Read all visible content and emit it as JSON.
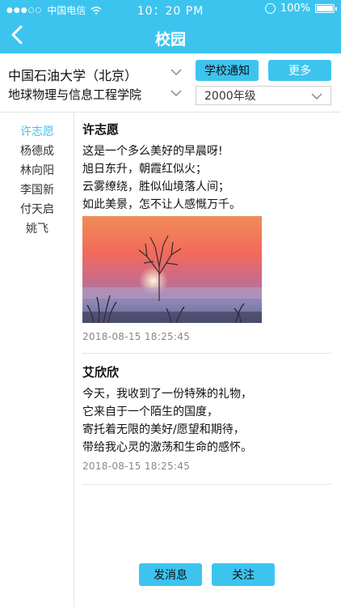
{
  "status_bar": {
    "carrier": "中国电信",
    "time": "10：20 PM",
    "battery": "100%"
  },
  "nav": {
    "title": "校园"
  },
  "filters": {
    "school": "中国石油大学（北京）",
    "college": "地球物理与信息工程学院",
    "grade": "2000年级",
    "notice_button": "学校通知",
    "more_button": "更多"
  },
  "sidebar": {
    "items": [
      {
        "label": "许志愿",
        "active": true
      },
      {
        "label": "杨德成"
      },
      {
        "label": "林向阳"
      },
      {
        "label": "李国新"
      },
      {
        "label": "付天启"
      },
      {
        "label": "姚飞"
      }
    ]
  },
  "posts": [
    {
      "author": "许志愿",
      "lines": [
        "这是一个多么美好的早晨呀!",
        "旭日东升，朝霞红似火；",
        "云雾缭绕，胜似仙境落人间；",
        "如此美景，怎不让人感慨万千。"
      ],
      "timestamp": "2018-08-15   18:25:45"
    },
    {
      "author": "艾欣欣",
      "lines": [
        "今天，我收到了一份特殊的礼物，",
        "它来自于一个陌生的国度，",
        "寄托着无限的美好/愿望和期待，",
        "带给我心灵的激荡和生命的感怀。"
      ],
      "timestamp": "2018-08-15   18:25:45"
    }
  ],
  "actions": {
    "message_button": "发消息",
    "follow_button": "关注"
  },
  "colors": {
    "accent": "#3cc4ef"
  },
  "icons": {
    "back": "back-arrow-icon",
    "chevron": "chevron-down-icon",
    "wifi": "wifi-icon",
    "battery": "battery-icon",
    "lock": "rotation-lock-icon"
  }
}
